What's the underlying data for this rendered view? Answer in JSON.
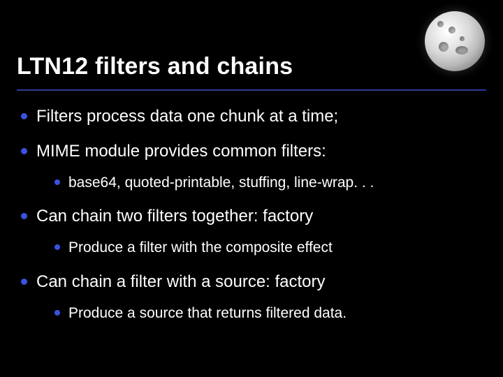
{
  "slide": {
    "title": "LTN12 filters and chains",
    "bullets": [
      {
        "text": "Filters process data one chunk at a time;",
        "sub": []
      },
      {
        "text": "MIME module provides common filters:",
        "sub": [
          {
            "text": "base64, quoted-printable, stuffing, line-wrap. . ."
          }
        ]
      },
      {
        "text": "Can chain two filters together: factory",
        "sub": [
          {
            "text": "Produce a filter with the composite effect"
          }
        ]
      },
      {
        "text": "Can chain a filter with a source: factory",
        "sub": [
          {
            "text": "Produce a source that returns filtered data."
          }
        ]
      }
    ],
    "accent_color": "#3a52e0",
    "divider_color": "#2a3a9a"
  }
}
